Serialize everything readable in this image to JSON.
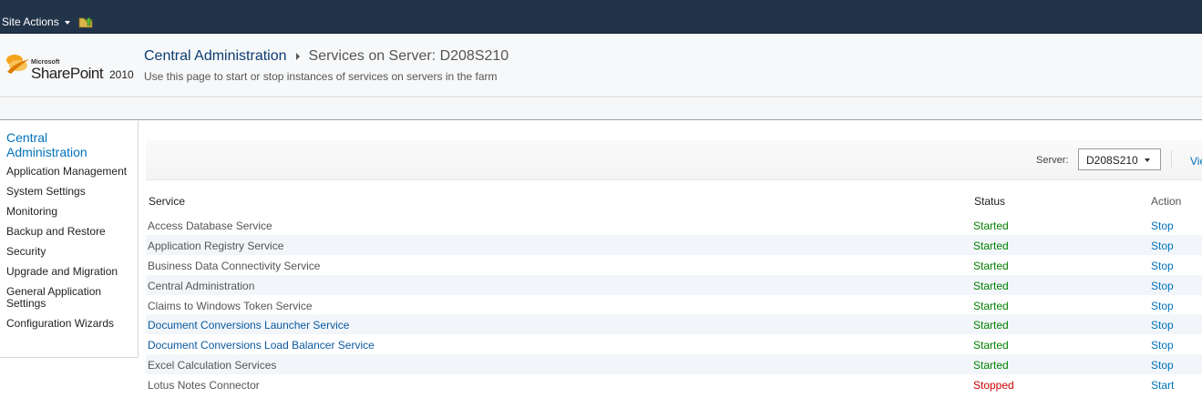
{
  "ribbon": {
    "site_actions": "Site Actions",
    "browse_icon": "folder-up-icon"
  },
  "header": {
    "logo": {
      "microsoft": "Microsoft",
      "product": "SharePoint",
      "year": "2010"
    },
    "breadcrumb_root": "Central Administration",
    "breadcrumb_current": "Services on Server: D208S210",
    "description": "Use this page to start or stop instances of services on servers in the farm"
  },
  "nav": {
    "heading": "Central Administration",
    "items": [
      "Application Management",
      "System Settings",
      "Monitoring",
      "Backup and Restore",
      "Security",
      "Upgrade and Migration",
      "General Application Settings",
      "Configuration Wizards"
    ]
  },
  "toolbar": {
    "server_label": "Server:",
    "server_value": "D208S210",
    "view_link": "View"
  },
  "table": {
    "columns": {
      "service": "Service",
      "status": "Status",
      "action": "Action"
    },
    "rows": [
      {
        "service": "Access Database Service",
        "status": "Started",
        "action": "Stop",
        "link": false
      },
      {
        "service": "Application Registry Service",
        "status": "Started",
        "action": "Stop",
        "link": false
      },
      {
        "service": "Business Data Connectivity Service",
        "status": "Started",
        "action": "Stop",
        "link": false
      },
      {
        "service": "Central Administration",
        "status": "Started",
        "action": "Stop",
        "link": false
      },
      {
        "service": "Claims to Windows Token Service",
        "status": "Started",
        "action": "Stop",
        "link": false
      },
      {
        "service": "Document Conversions Launcher Service",
        "status": "Started",
        "action": "Stop",
        "link": true
      },
      {
        "service": "Document Conversions Load Balancer Service",
        "status": "Started",
        "action": "Stop",
        "link": true
      },
      {
        "service": "Excel Calculation Services",
        "status": "Started",
        "action": "Stop",
        "link": false
      },
      {
        "service": "Lotus Notes Connector",
        "status": "Stopped",
        "action": "Start",
        "link": false
      }
    ]
  },
  "colors": {
    "topbar": "#22344a",
    "started": "#008000",
    "stopped": "#cc0000",
    "link": "#0072bc"
  }
}
